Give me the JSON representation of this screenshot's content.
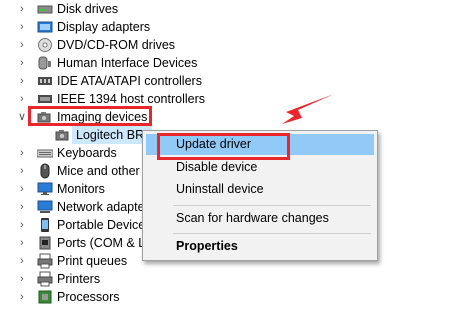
{
  "tree": {
    "items": [
      {
        "label": "Disk drives",
        "icon": "disk-drive-icon"
      },
      {
        "label": "Display adapters",
        "icon": "display-adapter-icon"
      },
      {
        "label": "DVD/CD-ROM drives",
        "icon": "dvd-drive-icon"
      },
      {
        "label": "Human Interface Devices",
        "icon": "hid-icon"
      },
      {
        "label": "IDE ATA/ATAPI controllers",
        "icon": "ide-controller-icon"
      },
      {
        "label": "IEEE 1394 host controllers",
        "icon": "firewire-icon"
      },
      {
        "label": "Imaging devices",
        "icon": "camera-icon",
        "expanded": true
      },
      {
        "label": "Logitech BRIO",
        "icon": "webcam-icon",
        "child": true,
        "selected": true
      },
      {
        "label": "Keyboards",
        "icon": "keyboard-icon"
      },
      {
        "label": "Mice and other",
        "icon": "mouse-icon"
      },
      {
        "label": "Monitors",
        "icon": "monitor-icon"
      },
      {
        "label": "Network adapters",
        "icon": "network-adapter-icon"
      },
      {
        "label": "Portable Devices",
        "icon": "portable-device-icon"
      },
      {
        "label": "Ports (COM & LPT)",
        "icon": "port-icon"
      },
      {
        "label": "Print queues",
        "icon": "print-queue-icon"
      },
      {
        "label": "Printers",
        "icon": "printer-icon"
      },
      {
        "label": "Processors",
        "icon": "processor-icon"
      }
    ]
  },
  "context_menu": {
    "update_driver": "Update driver",
    "disable_device": "Disable device",
    "uninstall_device": "Uninstall device",
    "scan_hardware": "Scan for hardware changes",
    "properties": "Properties"
  },
  "colors": {
    "highlight_red": "#e8262c",
    "menu_hover": "#91c9f7",
    "selection": "#cce8ff",
    "menu_bg": "#f2f2f2"
  }
}
